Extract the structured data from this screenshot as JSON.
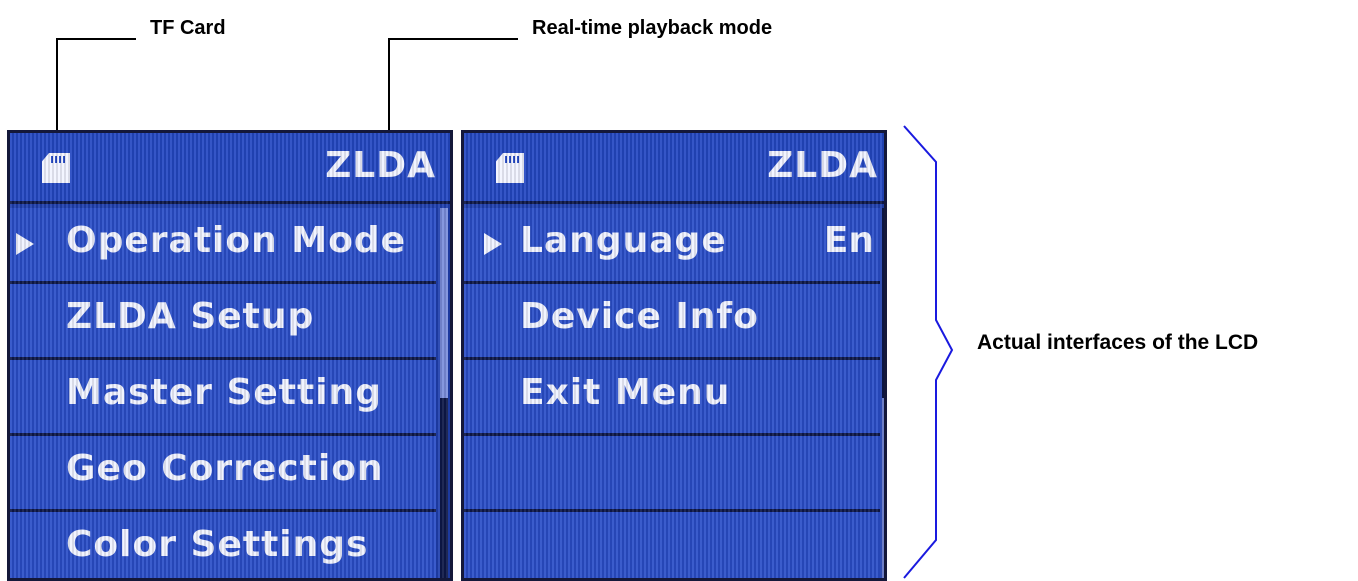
{
  "callouts": {
    "tf_card": "TF Card",
    "playback_mode": "Real-time playback mode",
    "actual_interfaces": "Actual interfaces of the LCD"
  },
  "screen_left": {
    "brand": "ZLDA",
    "menu": [
      {
        "label": "Operation Mode",
        "selected": true
      },
      {
        "label": "ZLDA Setup",
        "selected": false
      },
      {
        "label": "Master Setting",
        "selected": false
      },
      {
        "label": "Geo Correction",
        "selected": false
      },
      {
        "label": "Color Settings",
        "selected": false
      }
    ]
  },
  "screen_right": {
    "brand": "ZLDA",
    "menu": [
      {
        "label": "Language",
        "value": "En",
        "selected": true
      },
      {
        "label": "Device Info",
        "value": "",
        "selected": false
      },
      {
        "label": "Exit Menu",
        "value": "",
        "selected": false
      },
      {
        "label": "",
        "value": "",
        "selected": false
      },
      {
        "label": "",
        "value": "",
        "selected": false
      }
    ]
  },
  "colors": {
    "lcd_background": "#1f3fae",
    "lcd_text": "#f0f3ff",
    "bracket": "#1a1adf"
  },
  "icons": {
    "storage": "sd-card-icon",
    "selection": "triangle-right-icon"
  }
}
